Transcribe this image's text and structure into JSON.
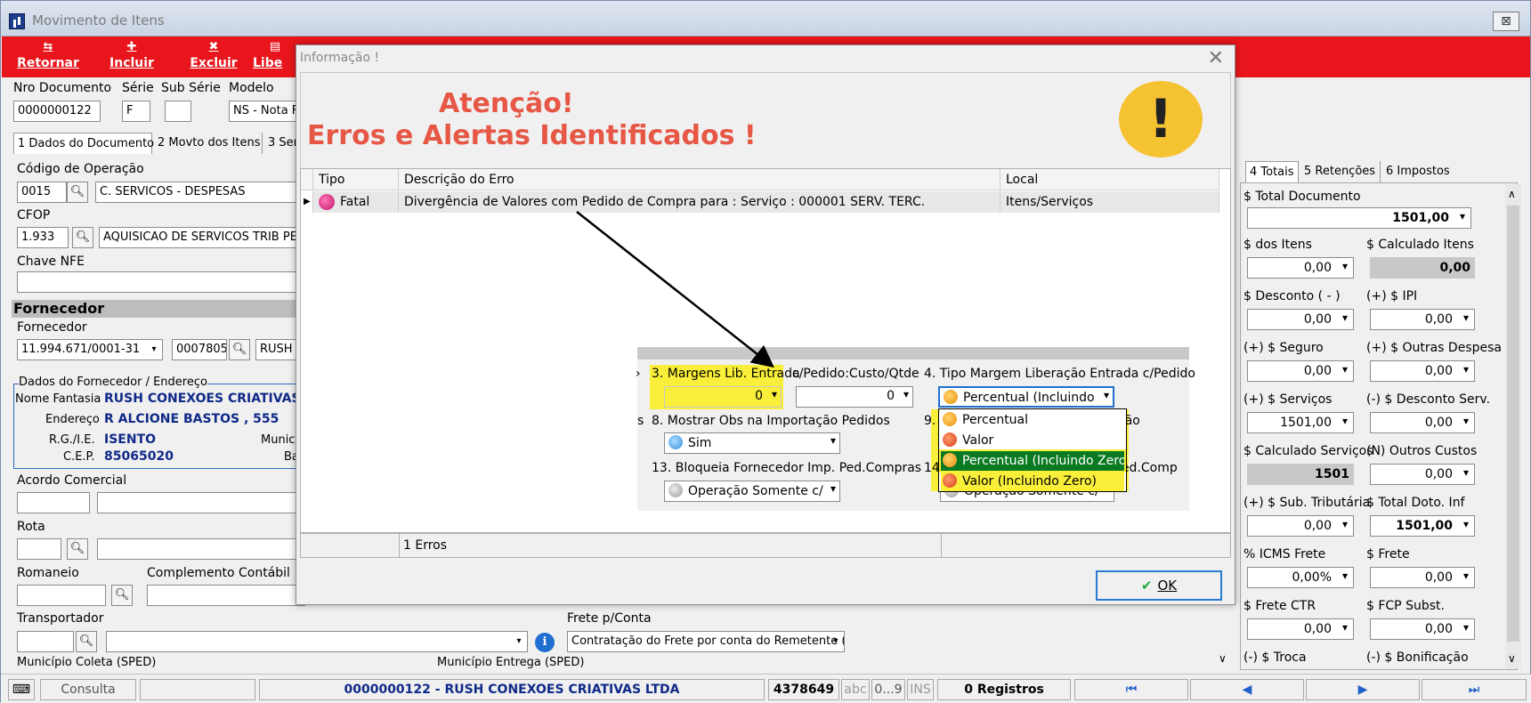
{
  "window": {
    "title": "Movimento de Itens",
    "close": "⊠"
  },
  "toolbar": {
    "items": [
      {
        "label": "Retornar",
        "icon": "⇆"
      },
      {
        "label": "Incluir",
        "icon": "✚"
      },
      {
        "label": "Excluir",
        "icon": "✖"
      },
      {
        "label": "Libe",
        "icon": "▤"
      }
    ]
  },
  "header": {
    "nro_label": "Nro Documento",
    "nro_value": "0000000122",
    "serie_label": "Série",
    "serie_value": "F",
    "subserie_label": "Sub Série",
    "subserie_value": "",
    "modelo_label": "Modelo",
    "modelo_value": "NS - Nota F"
  },
  "tabs": [
    "1 Dados do Documento",
    "2 Movto dos Itens",
    "3 Serv"
  ],
  "form": {
    "codop_label": "Código de Operação",
    "codop_value": "0015",
    "codop_desc": "C. SERVICOS - DESPESAS",
    "cfop_label": "CFOP",
    "cfop_value": "1.933",
    "cfop_desc": "AQUISICAO DE SERVICOS TRIB PE",
    "chave_label": "Chave NFE",
    "chave_value": "",
    "fornecedor_section": "Fornecedor",
    "fornecedor_label": "Fornecedor",
    "fornecedor_cnpj": "11.994.671/0001-31",
    "fornecedor_code": "0007805",
    "fornecedor_name": "RUSH",
    "dados_title": "Dados do Fornecedor / Endereço",
    "fantasia_label": "Nome Fantasia",
    "fantasia_value": "RUSH CONEXOES CRIATIVAS",
    "endereco_label": "Endereço",
    "endereco_value": "R ALCIONE BASTOS , 555",
    "rg_label": "R.G./I.E.",
    "rg_value": "ISENTO",
    "munic_label": "Municí",
    "cep_label": "C.E.P.",
    "cep_value": "85065020",
    "bairro_label": "Ba",
    "acordo_label": "Acordo Comercial",
    "rota_label": "Rota",
    "romaneio_label": "Romaneio",
    "complemento_label": "Complemento Contábil",
    "transportador_label": "Transportador",
    "frete_label": "Frete p/Conta",
    "frete_value": "Contratação do Frete por conta do Remetente (",
    "mun_coleta_label": "Município Coleta (SPED)",
    "mun_entrega_label": "Município Entrega (SPED)"
  },
  "right_panel": {
    "tabs": [
      "4 Totais",
      "5 Retenções",
      "6 Impostos"
    ],
    "total_doc_label": "$ Total Documento",
    "total_doc_value": "1501,00",
    "fields": [
      {
        "label": "$ dos Itens",
        "value": "0,00"
      },
      {
        "label": "$ Calculado Itens",
        "value": "0,00"
      },
      {
        "label": "$ Desconto ( - )",
        "value": "0,00"
      },
      {
        "label": "(+) $ IPI",
        "value": "0,00"
      },
      {
        "label": "(+) $ Seguro",
        "value": "0,00"
      },
      {
        "label": "(+) $ Outras Despesa",
        "value": "0,00"
      },
      {
        "label": "(+) $ Serviços",
        "value": "1501,00"
      },
      {
        "label": "(-) $ Desconto Serv.",
        "value": "0,00"
      },
      {
        "label": "$ Calculado Serviços",
        "value": "1501"
      },
      {
        "label": "(N) Outros Custos",
        "value": "0,00"
      },
      {
        "label": "(+) $ Sub. Tributária",
        "value": "0,00"
      },
      {
        "label": "$ Total Doto. Inf",
        "value": "1501,00"
      },
      {
        "label": "% ICMS Frete",
        "value": "0,00%"
      },
      {
        "label": "$ Frete",
        "value": "0,00"
      },
      {
        "label": "$ Frete CTR",
        "value": "0,00"
      },
      {
        "label": "$ FCP Subst.",
        "value": "0,00"
      },
      {
        "label": "(-) $ Troca",
        "value": ""
      },
      {
        "label": "(-) $ Bonificação",
        "value": ""
      }
    ]
  },
  "dialog": {
    "title": "Informação !",
    "close": "✕",
    "heading1": "Atenção!",
    "heading2": "Erros e Alertas Identificados !",
    "exclaim": "!",
    "columns": [
      "Tipo",
      "Descrição do Erro",
      "Local"
    ],
    "row": {
      "tipo": "Fatal",
      "descricao": "Divergência de Valores com Pedido de Compra para : Serviço : 000001 SERV. TERC.",
      "local": "Itens/Serviços"
    },
    "footer_count": "1 Erros",
    "ok": "OK"
  },
  "inset": {
    "margens_label": "3. Margens Lib. Entrada",
    "margens_value": "0",
    "custo_label": "c/Pedido:Custo/Qtde",
    "custo_value": "0",
    "tipo_label": "4. Tipo Margem Liberação Entrada c/Pedido",
    "tipo_value": "Percentual (Incluindo",
    "mostrar_label": "8. Mostrar Obs na Importação Pedidos",
    "mostrar_value": "Sim",
    "nine_label": "9.",
    "nine_suffix": "ção",
    "bloqueia_label": "13. Bloqueia Fornecedor Imp. Ped.Compras",
    "bloqueia_value": "Operação Somente c/",
    "fourteen_label": "14",
    "fourteen_suffix": "Ped.Comp",
    "op2_value": "Operação Somente c/",
    "left_s": "s",
    "left_arrow": "›",
    "options": [
      "Percentual",
      "Valor",
      "Percentual (Incluindo Zero)",
      "Valor (Incluindo Zero)"
    ]
  },
  "statusbar": {
    "consulta": "Consulta",
    "info": "0000000122 - RUSH CONEXOES CRIATIVAS LTDA",
    "num": "4378649",
    "abc": "abc",
    "range": "0...9",
    "ins": "INS",
    "registros": "0 Registros"
  }
}
